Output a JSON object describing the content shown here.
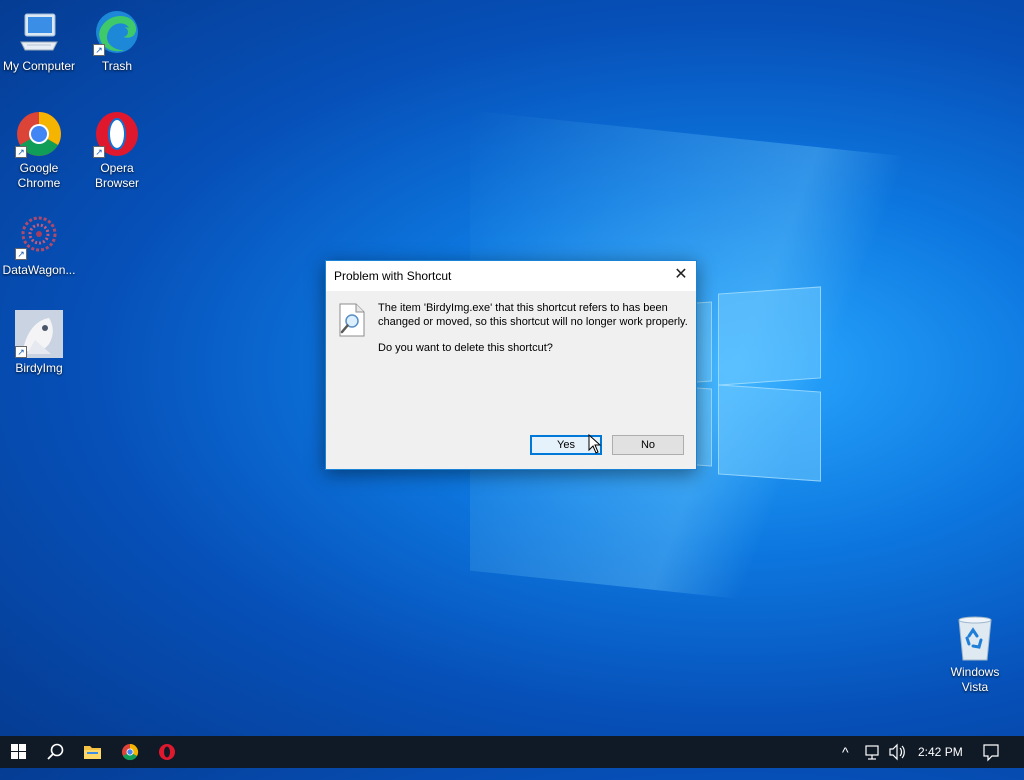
{
  "desktop": {
    "icons": [
      {
        "label": "My Computer",
        "icon": "computer-icon"
      },
      {
        "label": "Trash",
        "icon": "edge-icon"
      },
      {
        "label": "Google Chrome",
        "icon": "chrome-icon"
      },
      {
        "label": "Opera Browser",
        "icon": "opera-icon"
      },
      {
        "label": "DataWagon...",
        "icon": "datawagon-icon"
      },
      {
        "label": "BirdyImg",
        "icon": "birdyimg-icon"
      },
      {
        "label": "Windows Vista",
        "icon": "recycle-bin-icon"
      }
    ]
  },
  "dialog": {
    "title": "Problem with Shortcut",
    "close_glyph": "✕",
    "message": "The item 'BirdyImg.exe' that this shortcut refers to has been changed or moved, so this shortcut will no longer work properly.",
    "question": "Do you want to delete this shortcut?",
    "yes_label": "Yes",
    "no_label": "No"
  },
  "taskbar": {
    "pinned": [
      "start-icon",
      "search-icon",
      "file-explorer-icon",
      "chrome-icon",
      "opera-icon"
    ],
    "tray": {
      "chevron": "^",
      "clock": "2:42 PM"
    }
  },
  "colors": {
    "desktop_blue": "#0d78e0",
    "dialog_border": "#1883d7",
    "taskbar": "#101a27",
    "accent": "#0078d7"
  }
}
